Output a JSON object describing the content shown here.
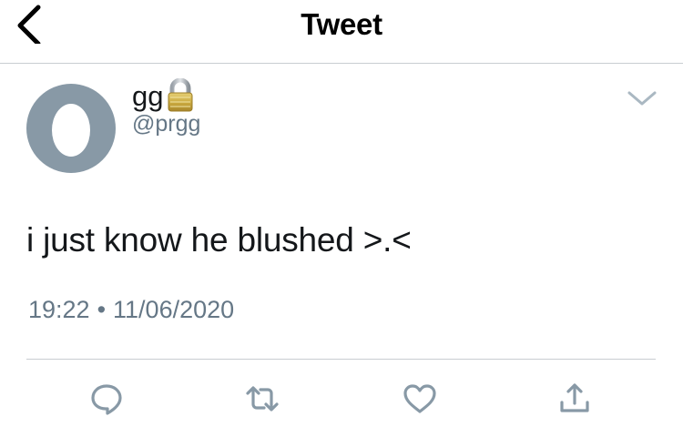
{
  "header": {
    "title": "Tweet",
    "back_icon": "chevron-left-icon"
  },
  "tweet": {
    "author": {
      "display_name": "gg",
      "handle": "@prgg",
      "protected_icon": "lock-icon",
      "avatar_icon": "default-egg-avatar"
    },
    "text": "i just know he blushed >.<",
    "time": "19:22",
    "separator": "•",
    "date": "11/06/2020",
    "menu_icon": "chevron-down-icon"
  },
  "actions": [
    {
      "icon": "reply-icon"
    },
    {
      "icon": "retweet-icon"
    },
    {
      "icon": "like-icon"
    },
    {
      "icon": "share-icon"
    }
  ],
  "colors": {
    "text": "#14171a",
    "secondary": "#657786",
    "icon": "#8899a6",
    "border": "#c9cdd1",
    "avatar_bg": "#8899a6"
  }
}
